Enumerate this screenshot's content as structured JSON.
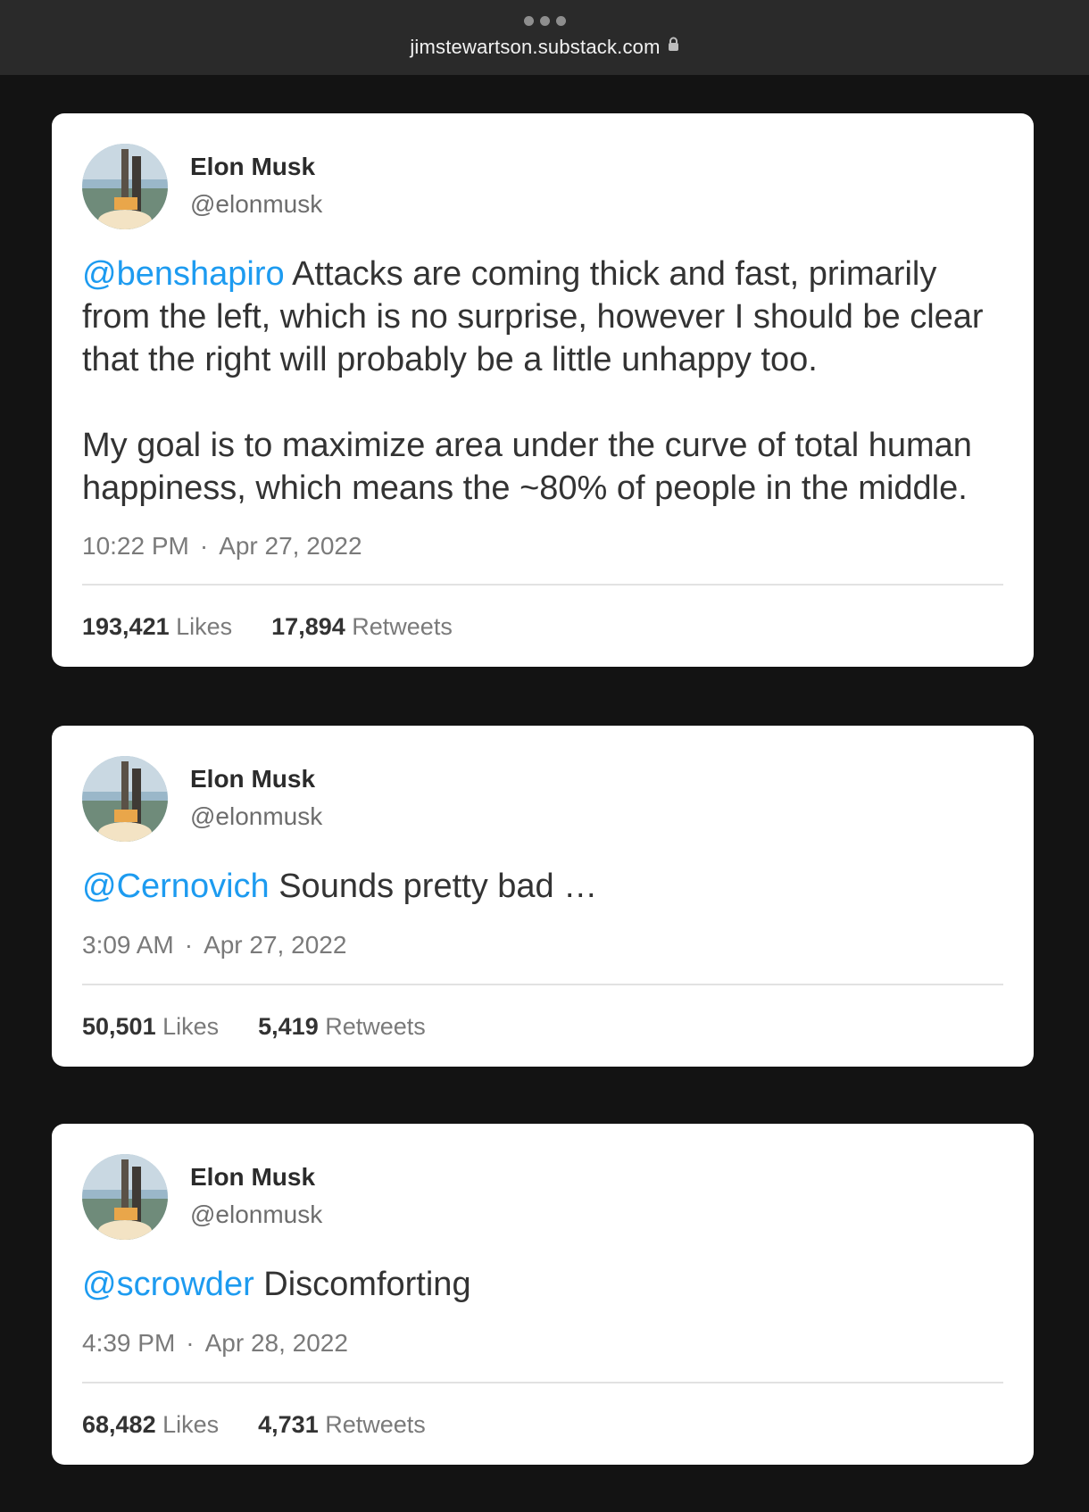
{
  "browser": {
    "url": "jimstewartson.substack.com"
  },
  "tweets": [
    {
      "name": "Elon Musk",
      "handle": "@elonmusk",
      "mention": "@benshapiro",
      "text1": " Attacks are coming thick and fast, primarily from the left, which is no surprise, however I should be clear that the right will probably be a little unhappy too.",
      "text2": "My goal is to maximize area under the curve of total human happiness, which means the ~80% of people in the middle.",
      "time": "10:22 PM",
      "date": "Apr 27, 2022",
      "likes": "193,421",
      "likes_label": "Likes",
      "retweets": "17,894",
      "retweets_label": "Retweets"
    },
    {
      "name": "Elon Musk",
      "handle": "@elonmusk",
      "mention": "@Cernovich",
      "text1": " Sounds pretty bad …",
      "time": "3:09 AM",
      "date": "Apr 27, 2022",
      "likes": "50,501",
      "likes_label": "Likes",
      "retweets": "5,419",
      "retweets_label": "Retweets"
    },
    {
      "name": "Elon Musk",
      "handle": "@elonmusk",
      "mention": "@scrowder",
      "text1": " Discomforting",
      "time": "4:39 PM",
      "date": "Apr 28, 2022",
      "likes": "68,482",
      "likes_label": "Likes",
      "retweets": "4,731",
      "retweets_label": "Retweets"
    }
  ],
  "separator": "·",
  "colors": {
    "mention": "#1d9bf0",
    "background": "#131313",
    "card": "#ffffff"
  }
}
